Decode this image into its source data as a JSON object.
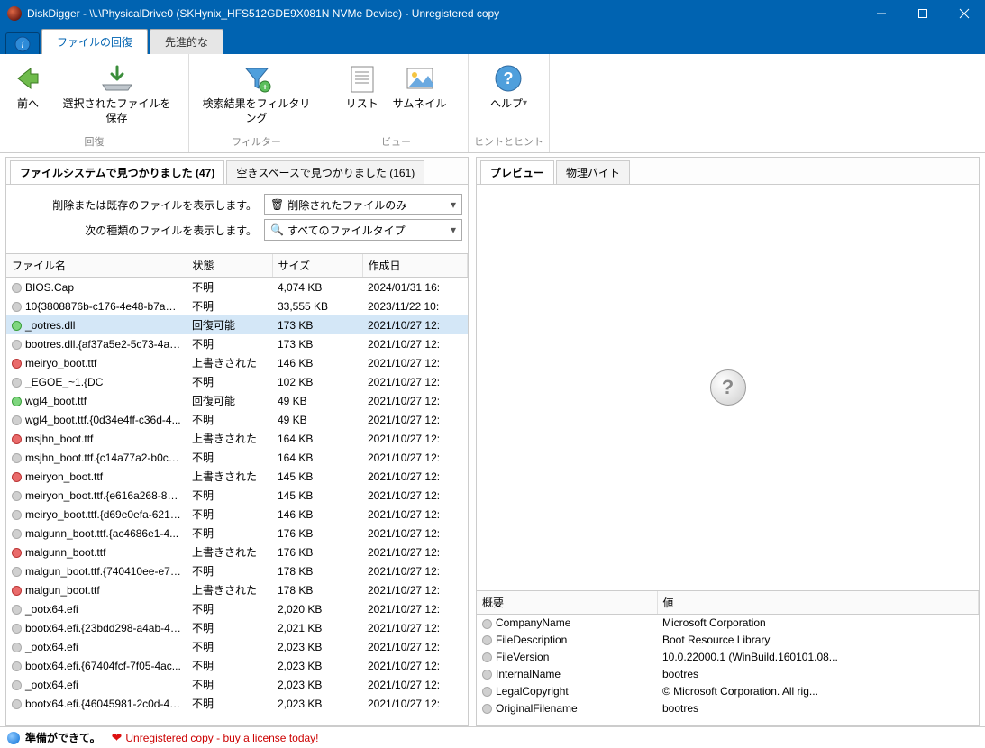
{
  "window": {
    "title": "DiskDigger - \\\\.\\PhysicalDrive0 (SKHynix_HFS512GDE9X081N NVMe Device) - Unregistered copy"
  },
  "tabs": {
    "file_recovery": "ファイルの回復",
    "advanced": "先進的な"
  },
  "ribbon": {
    "back": "前へ",
    "save_selected": "選択されたファイルを保存",
    "filter": "検索結果をフィルタリング",
    "list": "リスト",
    "thumbnail": "サムネイル",
    "help": "ヘルプ",
    "group_recover": "回復",
    "group_filter": "フィルター",
    "group_view": "ビュー",
    "group_help": "ヒントとヒント"
  },
  "left": {
    "tab_fs": "ファイルシステムで見つかりました (47)",
    "tab_free": "空きスペースで見つかりました (161)",
    "filter_label_show": "削除または既存のファイルを表示します。",
    "filter_value_show": "削除されたファイルのみ",
    "filter_label_type": "次の種類のファイルを表示します。",
    "filter_value_type": "すべてのファイルタイプ",
    "columns": {
      "name": "ファイル名",
      "state": "状態",
      "size": "サイズ",
      "date": "作成日"
    },
    "rows": [
      {
        "c": "gray",
        "n": "BIOS.Cap",
        "s": "不明",
        "z": "4,074 KB",
        "d": "2024/01/31 16:"
      },
      {
        "c": "gray",
        "n": "10{3808876b-c176-4e48-b7ae-0...",
        "s": "不明",
        "z": "33,555 KB",
        "d": "2023/11/22 10:"
      },
      {
        "c": "green",
        "n": "_ootres.dll",
        "s": "回復可能",
        "z": "173 KB",
        "d": "2021/10/27 12:",
        "sel": true
      },
      {
        "c": "gray",
        "n": "bootres.dll.{af37a5e2-5c73-4ab...",
        "s": "不明",
        "z": "173 KB",
        "d": "2021/10/27 12:"
      },
      {
        "c": "red",
        "n": "meiryo_boot.ttf",
        "s": "上書きされた",
        "z": "146 KB",
        "d": "2021/10/27 12:"
      },
      {
        "c": "gray",
        "n": "_EGOE_~1.{DC",
        "s": "不明",
        "z": "102 KB",
        "d": "2021/10/27 12:"
      },
      {
        "c": "green",
        "n": "wgl4_boot.ttf",
        "s": "回復可能",
        "z": "49 KB",
        "d": "2021/10/27 12:"
      },
      {
        "c": "gray",
        "n": "wgl4_boot.ttf.{0d34e4ff-c36d-4...",
        "s": "不明",
        "z": "49 KB",
        "d": "2021/10/27 12:"
      },
      {
        "c": "red",
        "n": "msjhn_boot.ttf",
        "s": "上書きされた",
        "z": "164 KB",
        "d": "2021/10/27 12:"
      },
      {
        "c": "gray",
        "n": "msjhn_boot.ttf.{c14a77a2-b0c9...",
        "s": "不明",
        "z": "164 KB",
        "d": "2021/10/27 12:"
      },
      {
        "c": "red",
        "n": "meiryon_boot.ttf",
        "s": "上書きされた",
        "z": "145 KB",
        "d": "2021/10/27 12:"
      },
      {
        "c": "gray",
        "n": "meiryon_boot.ttf.{e616a268-86...",
        "s": "不明",
        "z": "145 KB",
        "d": "2021/10/27 12:"
      },
      {
        "c": "gray",
        "n": "meiryo_boot.ttf.{d69e0efa-6219...",
        "s": "不明",
        "z": "146 KB",
        "d": "2021/10/27 12:"
      },
      {
        "c": "gray",
        "n": "malgunn_boot.ttf.{ac4686e1-4...",
        "s": "不明",
        "z": "176 KB",
        "d": "2021/10/27 12:"
      },
      {
        "c": "red",
        "n": "malgunn_boot.ttf",
        "s": "上書きされた",
        "z": "176 KB",
        "d": "2021/10/27 12:"
      },
      {
        "c": "gray",
        "n": "malgun_boot.ttf.{740410ee-e7e...",
        "s": "不明",
        "z": "178 KB",
        "d": "2021/10/27 12:"
      },
      {
        "c": "red",
        "n": "malgun_boot.ttf",
        "s": "上書きされた",
        "z": "178 KB",
        "d": "2021/10/27 12:"
      },
      {
        "c": "gray",
        "n": "_ootx64.efi",
        "s": "不明",
        "z": "2,020 KB",
        "d": "2021/10/27 12:"
      },
      {
        "c": "gray",
        "n": "bootx64.efi.{23bdd298-a4ab-43...",
        "s": "不明",
        "z": "2,021 KB",
        "d": "2021/10/27 12:"
      },
      {
        "c": "gray",
        "n": "_ootx64.efi",
        "s": "不明",
        "z": "2,023 KB",
        "d": "2021/10/27 12:"
      },
      {
        "c": "gray",
        "n": "bootx64.efi.{67404fcf-7f05-4ac...",
        "s": "不明",
        "z": "2,023 KB",
        "d": "2021/10/27 12:"
      },
      {
        "c": "gray",
        "n": "_ootx64.efi",
        "s": "不明",
        "z": "2,023 KB",
        "d": "2021/10/27 12:"
      },
      {
        "c": "gray",
        "n": "bootx64.efi.{46045981-2c0d-41...",
        "s": "不明",
        "z": "2,023 KB",
        "d": "2021/10/27 12:"
      }
    ]
  },
  "right": {
    "tab_preview": "プレビュー",
    "tab_bytes": "物理バイト",
    "props_columns": {
      "key": "概要",
      "value": "値"
    },
    "props": [
      {
        "k": "CompanyName",
        "v": "Microsoft Corporation"
      },
      {
        "k": "FileDescription",
        "v": "Boot Resource Library"
      },
      {
        "k": "FileVersion",
        "v": "10.0.22000.1 (WinBuild.160101.08..."
      },
      {
        "k": "InternalName",
        "v": "bootres"
      },
      {
        "k": "LegalCopyright",
        "v": "© Microsoft Corporation. All rig..."
      },
      {
        "k": "OriginalFilename",
        "v": "bootres"
      }
    ]
  },
  "status": {
    "ready": "準備ができて。",
    "license_link": "Unregistered copy - buy a license today!"
  }
}
